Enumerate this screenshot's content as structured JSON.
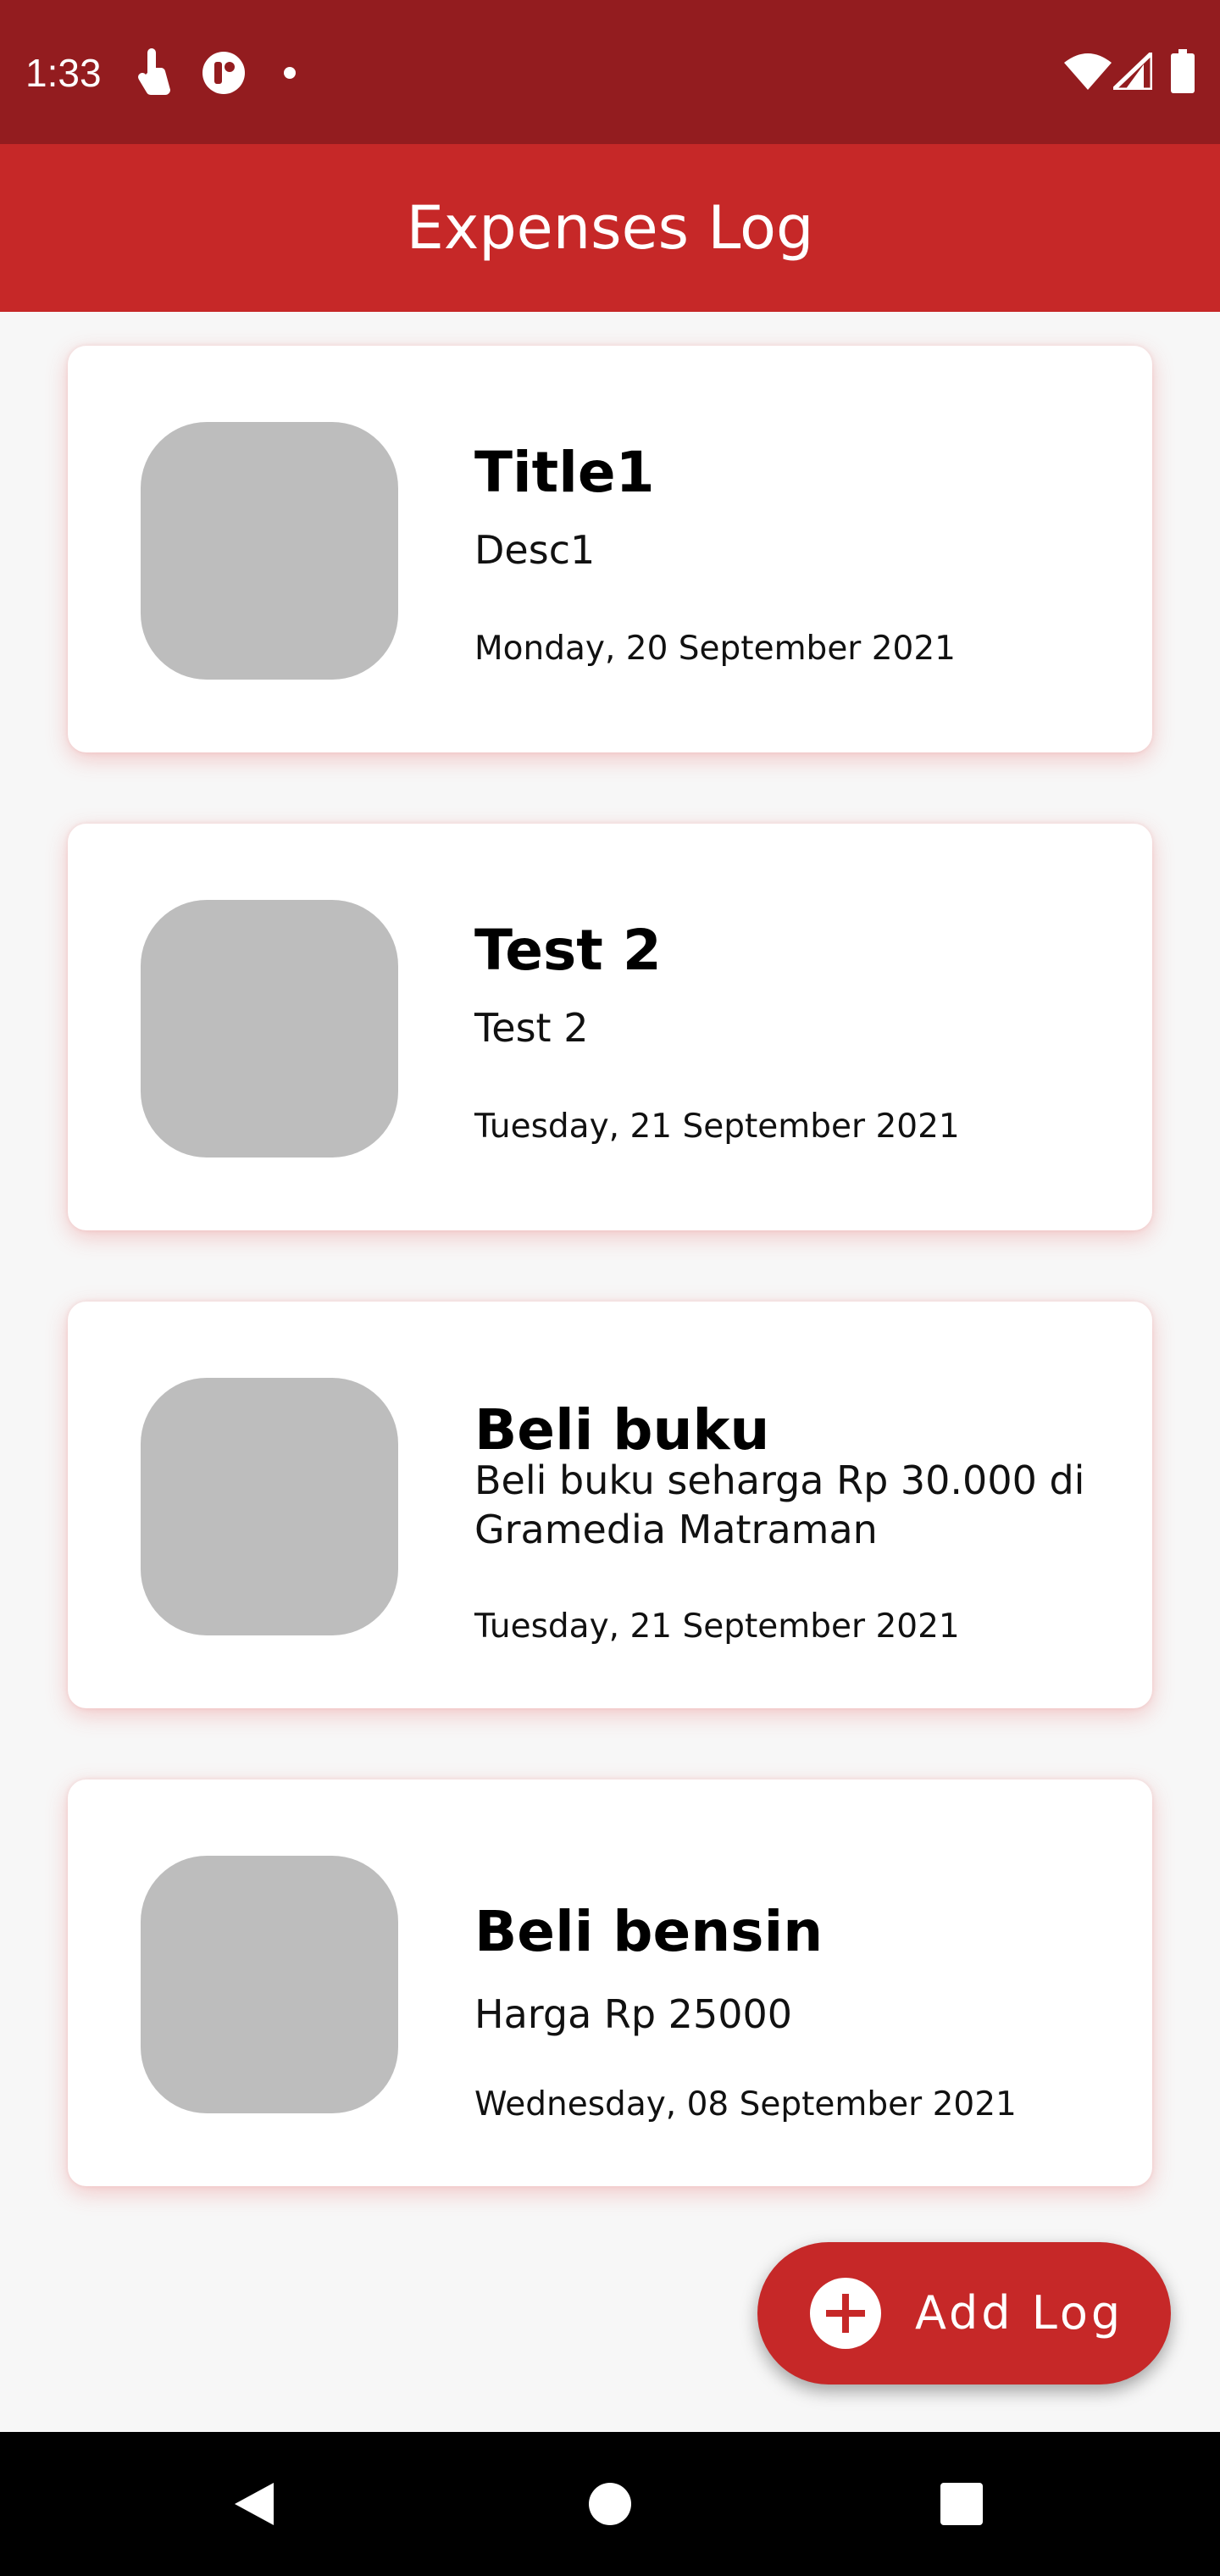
{
  "status_bar": {
    "time": "1:33",
    "icons": [
      "touch-icon",
      "app-icon",
      "dot-icon",
      "wifi-icon",
      "signal-icon",
      "battery-icon"
    ]
  },
  "app_bar": {
    "title": "Expenses Log",
    "color": "#c62828"
  },
  "logs": [
    {
      "title": "Title1",
      "desc": "Desc1",
      "date": "Monday, 20 September 2021"
    },
    {
      "title": "Test 2",
      "desc": "Test 2",
      "date": "Tuesday, 21 September 2021"
    },
    {
      "title": "Beli buku",
      "desc": "Beli buku seharga Rp 30.000 di Gramedia Matraman",
      "date": "Tuesday, 21 September 2021"
    },
    {
      "title": "Beli bensin",
      "desc": "Harga Rp 25000",
      "date": "Wednesday, 08 September 2021"
    }
  ],
  "fab": {
    "label": "Add Log",
    "icon": "plus-circle-icon"
  },
  "nav_bar": {
    "icons": [
      "back-icon",
      "home-icon",
      "recents-icon"
    ]
  }
}
